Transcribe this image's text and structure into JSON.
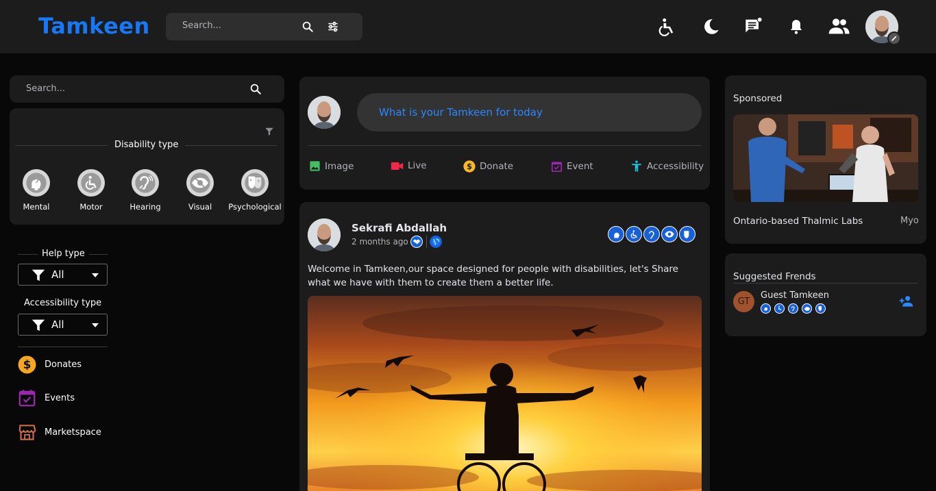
{
  "header": {
    "logo": "Tamkeen",
    "search_placeholder": "Search..."
  },
  "left": {
    "search_placeholder": "Search...",
    "disability_title": "Disability type",
    "disabilities": [
      {
        "label": "Mental",
        "icon": "head-icon"
      },
      {
        "label": "Motor",
        "icon": "wheelchair-icon"
      },
      {
        "label": "Hearing",
        "icon": "ear-icon"
      },
      {
        "label": "Visual",
        "icon": "eye-icon"
      },
      {
        "label": "Psychological",
        "icon": "mask-icon"
      }
    ],
    "help_type_label": "Help type",
    "help_type_value": "All",
    "accessibility_type_label": "Accessibility type",
    "accessibility_type_value": "All",
    "nav": [
      {
        "label": "Donates",
        "icon": "dollar-icon",
        "color": "#f5a623"
      },
      {
        "label": "Events",
        "icon": "calendar-icon",
        "color": "#9c27b0"
      },
      {
        "label": "Marketspace",
        "icon": "store-icon",
        "color": "#d4714a"
      }
    ]
  },
  "composer": {
    "placeholder": "What is your Tamkeen for today",
    "actions": [
      {
        "label": "Image",
        "icon": "image-icon",
        "color": "#45bd62"
      },
      {
        "label": "Live",
        "icon": "video-icon",
        "color": "#f02849"
      },
      {
        "label": "Donate",
        "icon": "dollar-icon",
        "color": "#f7b928"
      },
      {
        "label": "Event",
        "icon": "calendar-icon",
        "color": "#9c27b0"
      },
      {
        "label": "Accessibility",
        "icon": "accessibility-icon",
        "color": "#1bc2d8"
      }
    ]
  },
  "post": {
    "author": "Sekrafi Abdallah",
    "time": "2 months ago .",
    "text": "Welcome in Tamkeen,our space designed for people with disabilities, let's Share what we have with them to create them a better life."
  },
  "sponsored": {
    "title": "Sponsored",
    "caption": "Ontario-based Thalmic Labs",
    "caption_right": "Myo"
  },
  "suggested": {
    "title": "Suggested Frends",
    "name": "Guest Tamkeen",
    "initials": "GT"
  },
  "colors": {
    "accent": "#1877f2",
    "panel": "#1c1c1c",
    "background": "#080808"
  }
}
